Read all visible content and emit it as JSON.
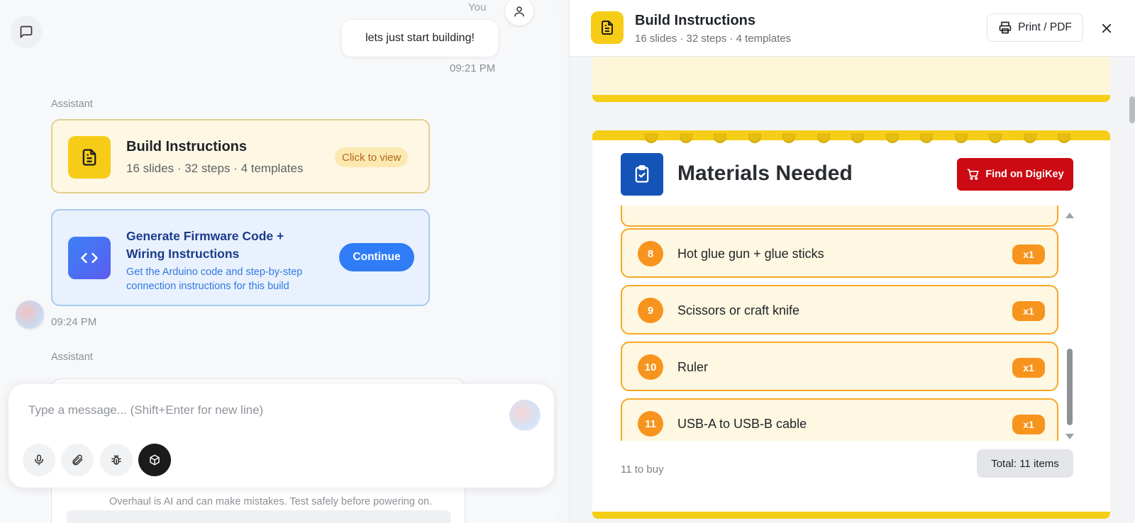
{
  "chat": {
    "user_label": "You",
    "user_message": "lets just start building!",
    "user_time": "09:21 PM",
    "assistant_label": "Assistant",
    "build_card": {
      "title": "Build Instructions",
      "subtitle": "16 slides · 32 steps · 4 templates",
      "action": "Click to view"
    },
    "firmware_card": {
      "title": "Generate Firmware Code + Wiring Instructions",
      "subtitle": "Get the Arduino code and step-by-step connection instructions for this build",
      "button": "Continue"
    },
    "assistant_time": "09:24 PM",
    "composer_placeholder": "Type a message... (Shift+Enter for new line)",
    "disclaimer": "Overhaul is AI and can make mistakes. Test safely before powering on."
  },
  "viewer": {
    "title": "Build Instructions",
    "subtitle": "16 slides · 32 steps · 4 templates",
    "print_label": "Print / PDF",
    "slide": {
      "title": "Materials Needed",
      "digikey_label": "Find on DigiKey",
      "items": [
        {
          "num": "8",
          "name": "Hot glue gun + glue sticks",
          "qty": "x1"
        },
        {
          "num": "9",
          "name": "Scissors or craft knife",
          "qty": "x1"
        },
        {
          "num": "10",
          "name": "Ruler",
          "qty": "x1"
        },
        {
          "num": "11",
          "name": "USB-A to USB-B cable",
          "qty": "x1"
        }
      ],
      "footer_left": "11 to buy",
      "total_label": "Total: 11 items"
    }
  },
  "colors": {
    "accent_yellow": "#f6cc17",
    "accent_blue": "#2f7cf6",
    "orange": "#f7941d",
    "digikey_red": "#cc0a13"
  }
}
